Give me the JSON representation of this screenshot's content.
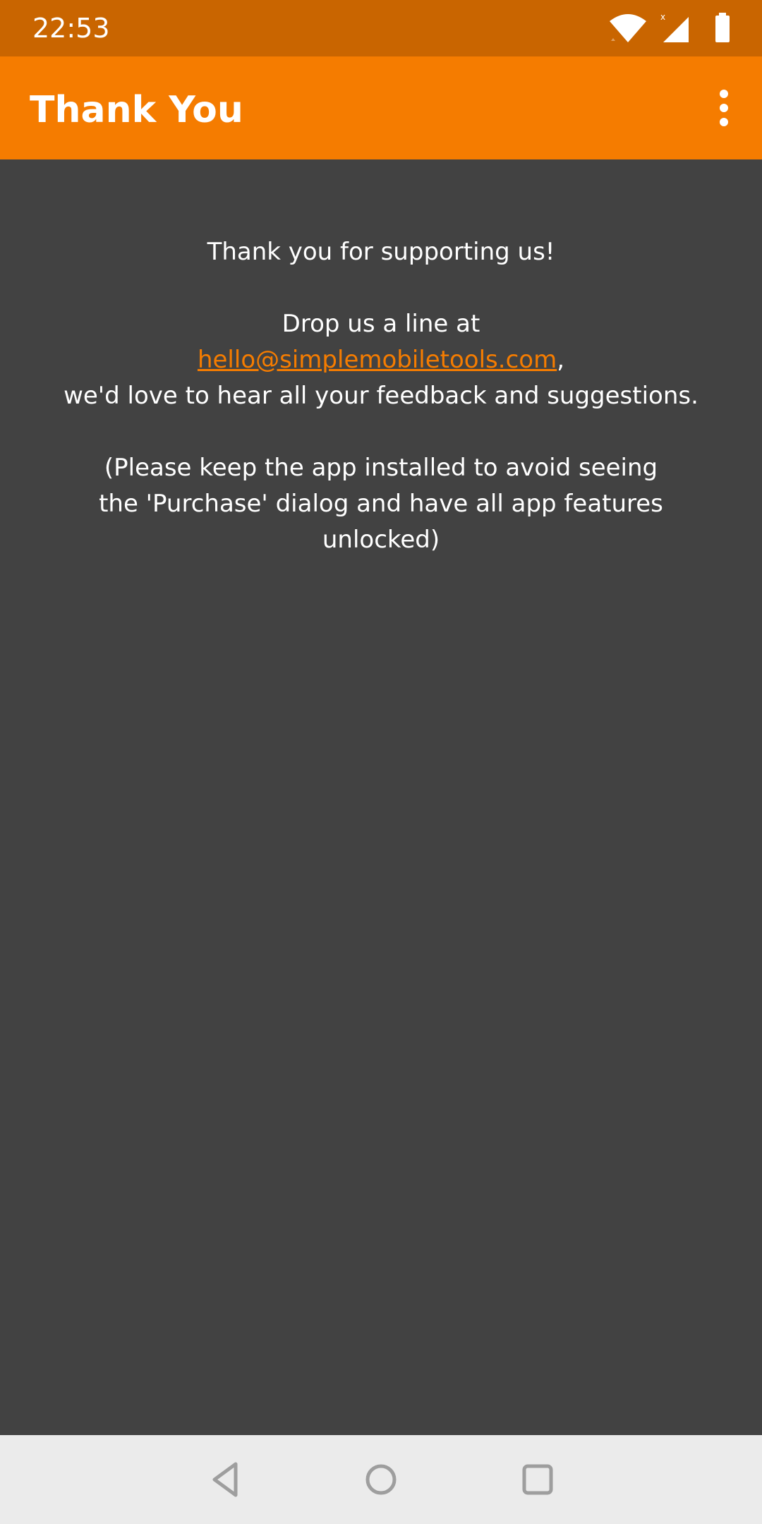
{
  "status_bar": {
    "time": "22:53",
    "icons": [
      "wifi-icon",
      "signal-icon",
      "battery-icon"
    ],
    "background": "#C96500"
  },
  "app_bar": {
    "title": "Thank You",
    "menu_icon": "more-vert-icon",
    "background": "#F57C00"
  },
  "message": {
    "line1": "Thank you for supporting us!",
    "line2": "Drop us a line at",
    "email": "hello@simplemobiletools.com",
    "email_suffix": ",",
    "line3": "we'd love to hear all your feedback and suggestions.",
    "line4": "(Please keep the app installed to avoid seeing",
    "line5": "the 'Purchase' dialog and have all app features",
    "line6": "unlocked)"
  },
  "colors": {
    "accent": "#F57C00",
    "background": "#424242",
    "text": "#FFFFFF",
    "nav_bar": "#EBEBEB"
  },
  "nav_bar": {
    "buttons": [
      "back-icon",
      "home-icon",
      "recents-icon"
    ]
  }
}
